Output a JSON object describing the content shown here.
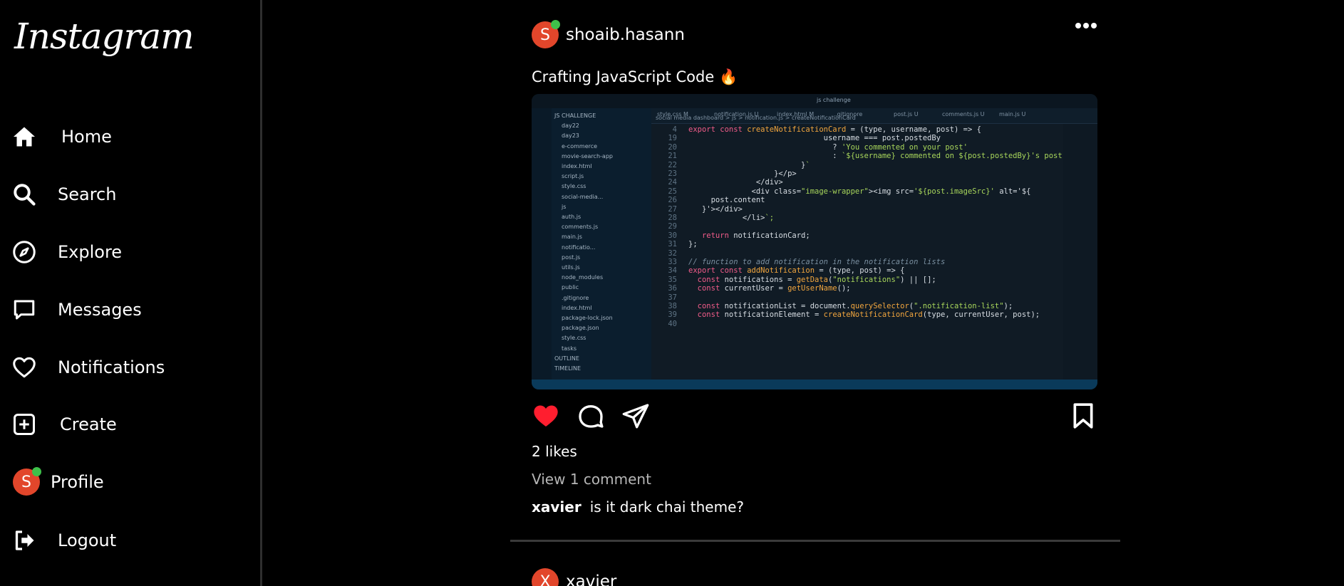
{
  "app": {
    "name": "Instagram"
  },
  "sidebar": {
    "items": [
      {
        "label": "Home",
        "icon": "home-icon"
      },
      {
        "label": "Search",
        "icon": "search-icon"
      },
      {
        "label": "Explore",
        "icon": "compass-icon"
      },
      {
        "label": "Messages",
        "icon": "message-icon"
      },
      {
        "label": "Notifications",
        "icon": "heart-icon"
      },
      {
        "label": "Create",
        "icon": "plus-square-icon"
      },
      {
        "label": "Profile",
        "icon": "avatar",
        "avatar_letter": "S"
      },
      {
        "label": "Logout",
        "icon": "logout-icon"
      }
    ]
  },
  "post": {
    "avatar_letter": "S",
    "username": "shoaib.hasann",
    "caption": "Crafting JavaScript Code",
    "caption_emoji": "🔥",
    "likes": "2 likes",
    "view_comments": "View 1 comment",
    "comment": {
      "author": "xavier",
      "text": "is it dark chai theme?"
    },
    "liked": true,
    "image": {
      "title": "js challenge",
      "tabs": [
        "style.css M",
        "notification.js U",
        "index.html M",
        ".gitignore",
        "post.js U",
        "comments.js U",
        "main.js U"
      ],
      "breadcrumb": "social media dashboard > js > notification.js > createNotificationCard",
      "tree": [
        "JS CHALLENGE",
        "day22",
        "day23",
        "e-commerce",
        "movie-search-app",
        "index.html",
        "script.js",
        "style.css",
        "social-media...",
        "js",
        "auth.js",
        "comments.js",
        "main.js",
        "notificatio...",
        "post.js",
        "utils.js",
        "node_modules",
        "public",
        ".gitignore",
        "index.html",
        "package-lock.json",
        "package.json",
        "style.css",
        "tasks",
        "OUTLINE",
        "TIMELINE"
      ],
      "code": [
        {
          "n": "4",
          "t": "export const createNotificationCard = (type, username, post) => {"
        },
        {
          "n": "19",
          "t": "                              username === post.postedBy"
        },
        {
          "n": "20",
          "t": "                                ? 'You commented on your post'"
        },
        {
          "n": "21",
          "t": "                                : `${username} commented on ${post.postedBy}'s post.`"
        },
        {
          "n": "22",
          "t": "                         }`"
        },
        {
          "n": "23",
          "t": "                   }</p>"
        },
        {
          "n": "24",
          "t": "               </div>"
        },
        {
          "n": "25",
          "t": "              <div class=\"image-wrapper\"><img src='${post.imageSrc}' alt='${"
        },
        {
          "n": "26",
          "t": "     post.content"
        },
        {
          "n": "27",
          "t": "   }'></div>"
        },
        {
          "n": "28",
          "t": "            </li>`;"
        },
        {
          "n": "29",
          "t": ""
        },
        {
          "n": "30",
          "t": "   return notificationCard;"
        },
        {
          "n": "31",
          "t": "};"
        },
        {
          "n": "32",
          "t": ""
        },
        {
          "n": "33",
          "t": "// function to add notification in the notification lists"
        },
        {
          "n": "34",
          "t": "export const addNotification = (type, post) => {"
        },
        {
          "n": "35",
          "t": "  const notifications = getData(\"notifications\") || [];"
        },
        {
          "n": "36",
          "t": "  const currentUser = getUserName();"
        },
        {
          "n": "37",
          "t": ""
        },
        {
          "n": "38",
          "t": "  const notificationList = document.querySelector(\".notification-list\");"
        },
        {
          "n": "39",
          "t": "  const notificationElement = createNotificationCard(type, currentUser, post);"
        },
        {
          "n": "40",
          "t": ""
        }
      ]
    }
  },
  "next_post": {
    "avatar_letter": "X",
    "username": "xavier"
  },
  "colors": {
    "accent_avatar": "#e2462b",
    "online": "#3ec14a",
    "like": "#ff1e2f",
    "background": "#000000"
  }
}
